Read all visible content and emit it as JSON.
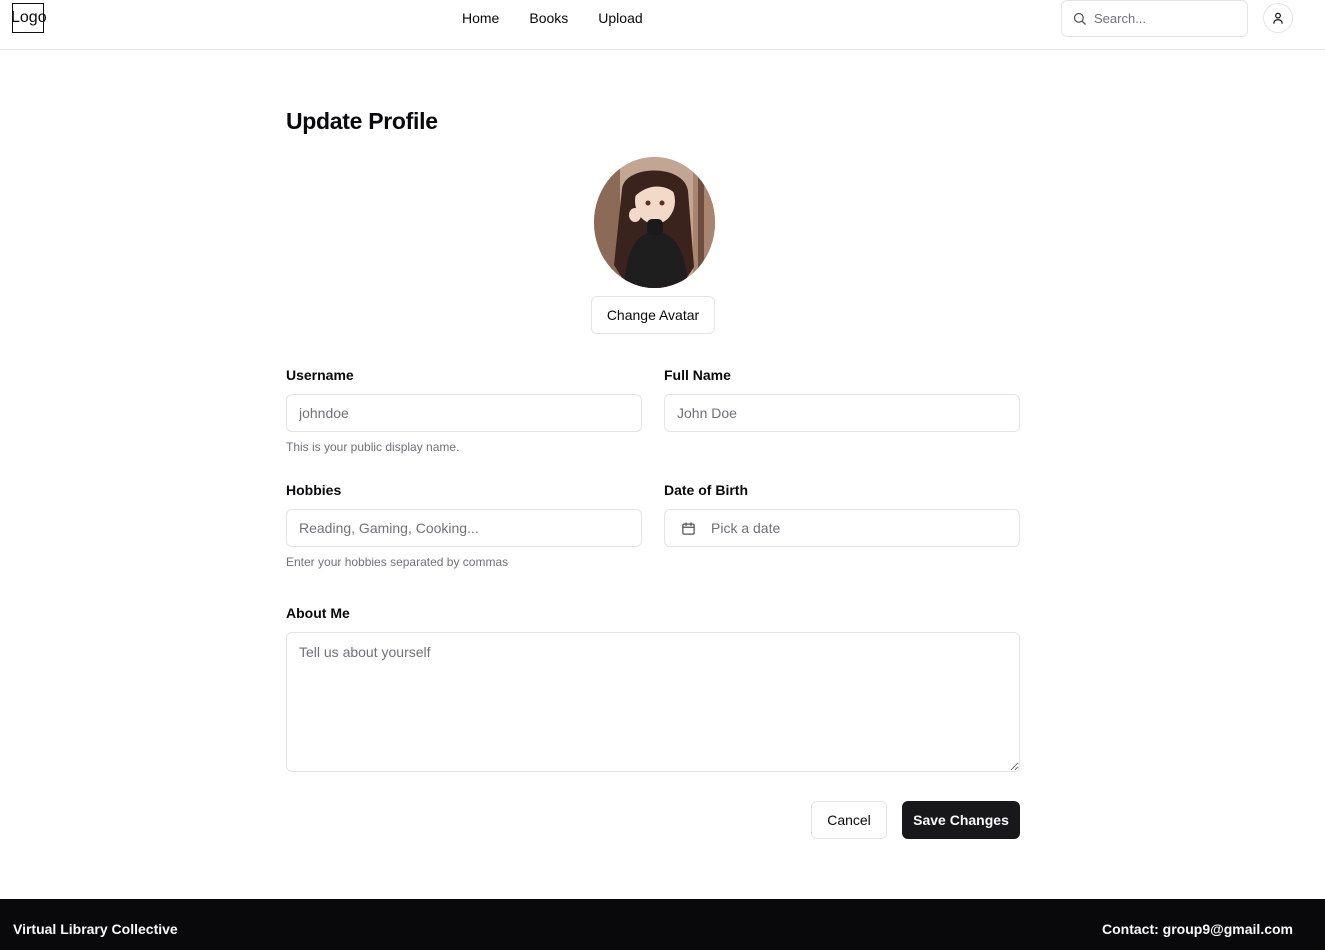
{
  "header": {
    "logo_text": "Logo",
    "nav": [
      "Home",
      "Books",
      "Upload"
    ],
    "search_placeholder": "Search...",
    "icons": {
      "search": "search-icon",
      "user": "user-icon"
    }
  },
  "profile": {
    "title": "Update Profile",
    "change_avatar_label": "Change Avatar",
    "fields": {
      "username": {
        "label": "Username",
        "placeholder": "johndoe",
        "help": "This is your public display name."
      },
      "full_name": {
        "label": "Full Name",
        "placeholder": "John Doe"
      },
      "hobbies": {
        "label": "Hobbies",
        "placeholder": "Reading, Gaming, Cooking...",
        "help": "Enter your hobbies separated by commas"
      },
      "dob": {
        "label": "Date of Birth",
        "placeholder": "Pick a date"
      },
      "about": {
        "label": "About Me",
        "placeholder": "Tell us about yourself"
      }
    },
    "cancel_label": "Cancel",
    "save_label": "Save Changes"
  },
  "footer": {
    "brand": "Virtual Library Collective",
    "contact": "Contact: group9@gmail.com"
  },
  "colors": {
    "primary": "#18181b",
    "border": "#e4e4e7",
    "muted_text": "#71717a",
    "footer_bg": "#09090b"
  }
}
